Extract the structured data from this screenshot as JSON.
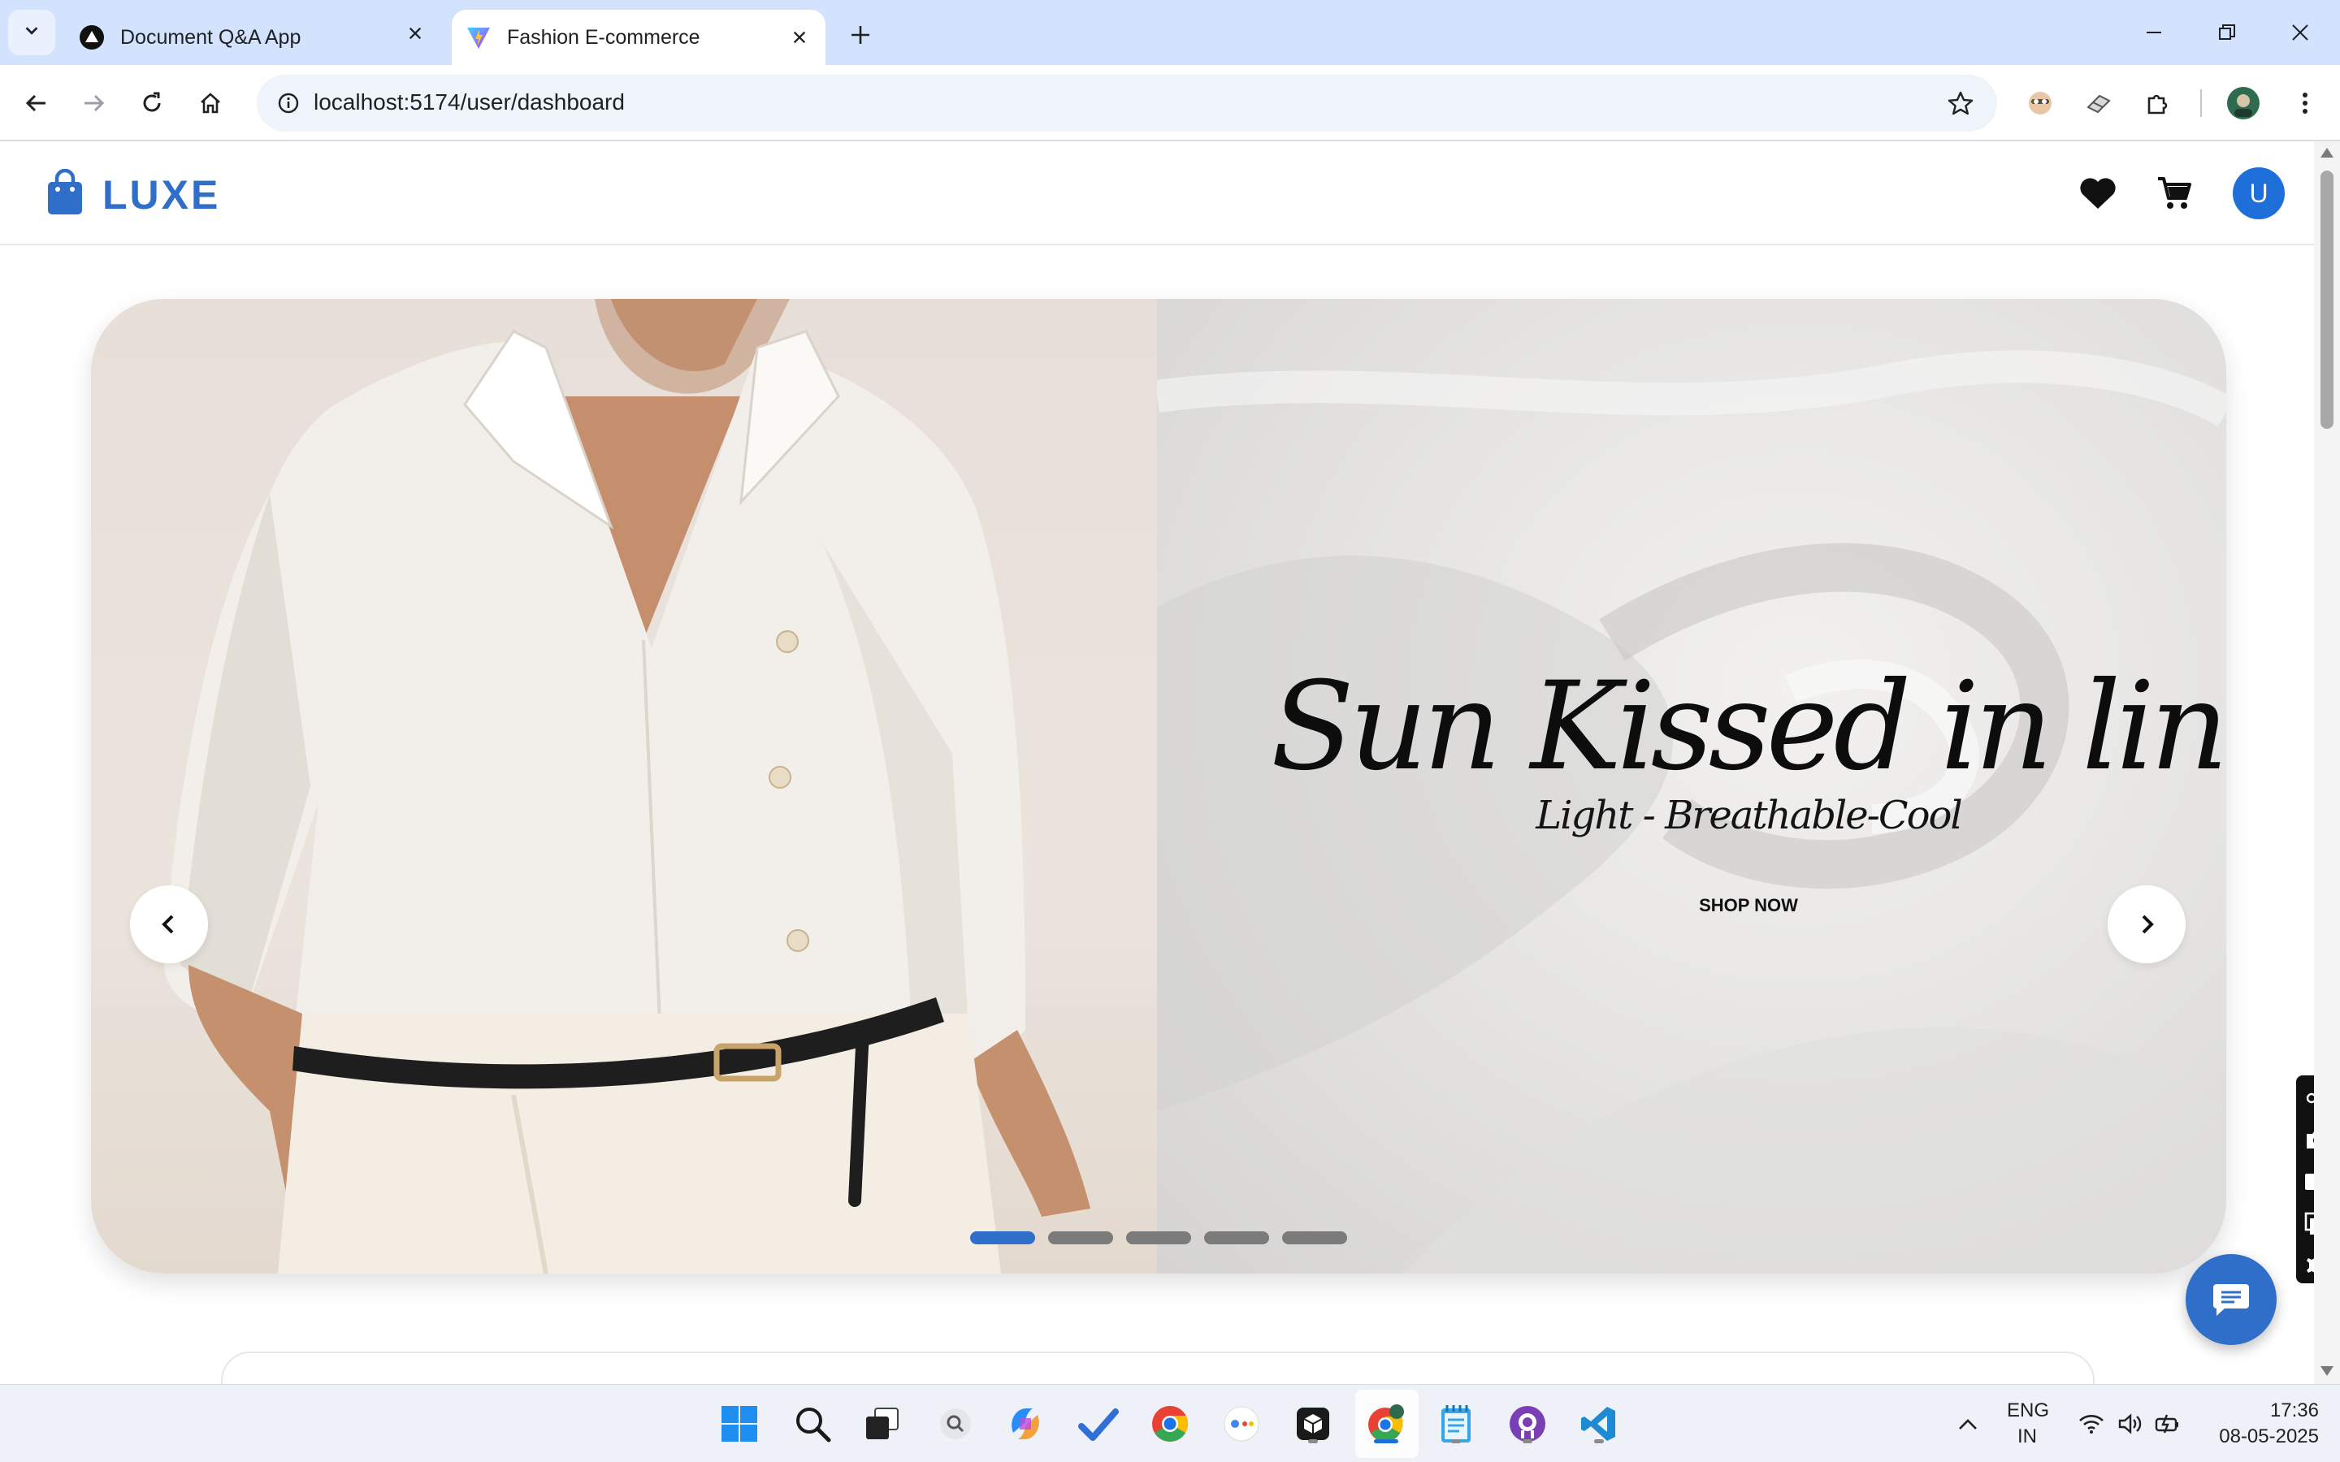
{
  "browser": {
    "tabs": [
      {
        "title": "Document Q&A App",
        "active": false
      },
      {
        "title": "Fashion E-commerce",
        "active": true
      }
    ],
    "url": "localhost:5174/user/dashboard"
  },
  "site": {
    "brand": "LUXE",
    "avatar_initial": "U",
    "brand_color": "#2f6fc9"
  },
  "hero": {
    "title": "Sun Kissed in linen",
    "subtitle": "Light - Breathable-Cool",
    "cta": "SHOP NOW",
    "slide_count": 5,
    "active_slide": 1
  },
  "taskbar": {
    "lang_line1": "ENG",
    "lang_line2": "IN",
    "time": "17:36",
    "date": "08-05-2025"
  }
}
